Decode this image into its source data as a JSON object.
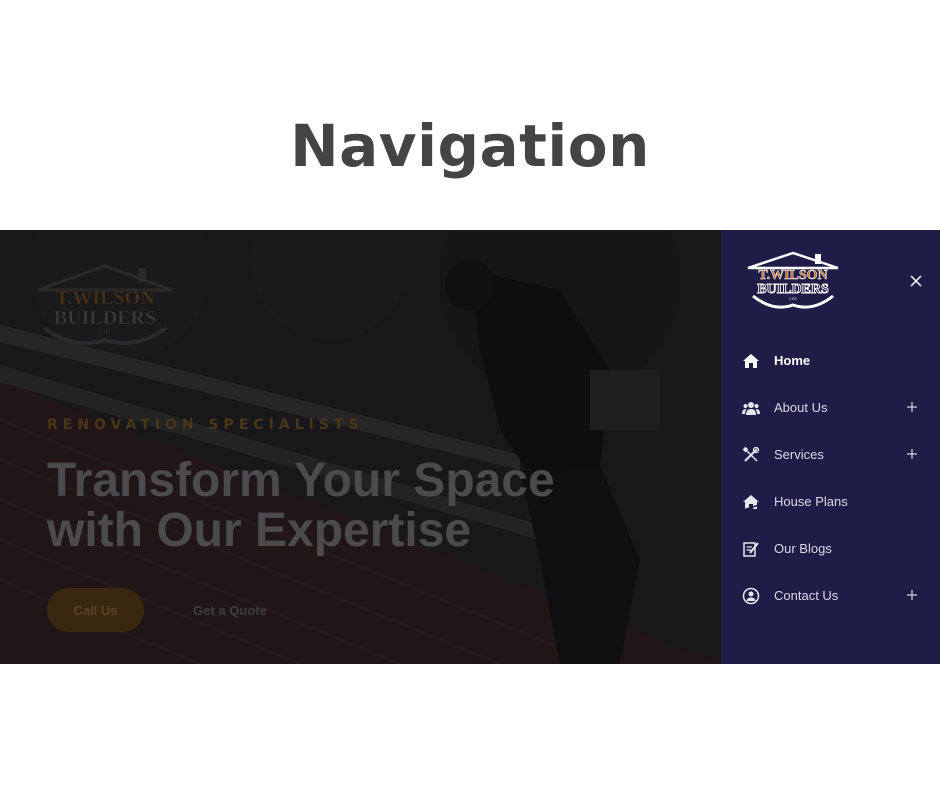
{
  "page": {
    "heading": "Navigation"
  },
  "hero": {
    "logo": {
      "line1": "T.WILSON",
      "line2": "BUILDERS",
      "line3": "LTD"
    },
    "eyebrow": "RENOVATION SPECIALISTS",
    "title_line1": "Transform Your Space",
    "title_line2": "with Our Expertise",
    "call_button": "Call Us",
    "quote_button": "Get a Quote"
  },
  "drawer": {
    "logo": {
      "line1": "T.WILSON",
      "line2": "BUILDERS",
      "line3": "LTD"
    },
    "close_icon": "close-icon",
    "items": [
      {
        "label": "Home",
        "icon": "home-icon",
        "expandable": false,
        "active": true
      },
      {
        "label": "About Us",
        "icon": "users-icon",
        "expandable": true,
        "active": false
      },
      {
        "label": "Services",
        "icon": "tools-icon",
        "expandable": true,
        "active": false
      },
      {
        "label": "House Plans",
        "icon": "house-plans-icon",
        "expandable": false,
        "active": false
      },
      {
        "label": "Our Blogs",
        "icon": "blog-edit-icon",
        "expandable": false,
        "active": false
      },
      {
        "label": "Contact Us",
        "icon": "contact-icon",
        "expandable": true,
        "active": false
      }
    ]
  },
  "colors": {
    "drawer_bg": "#1f1d47",
    "accent_orange": "#c4681e",
    "heading": "#444444"
  }
}
